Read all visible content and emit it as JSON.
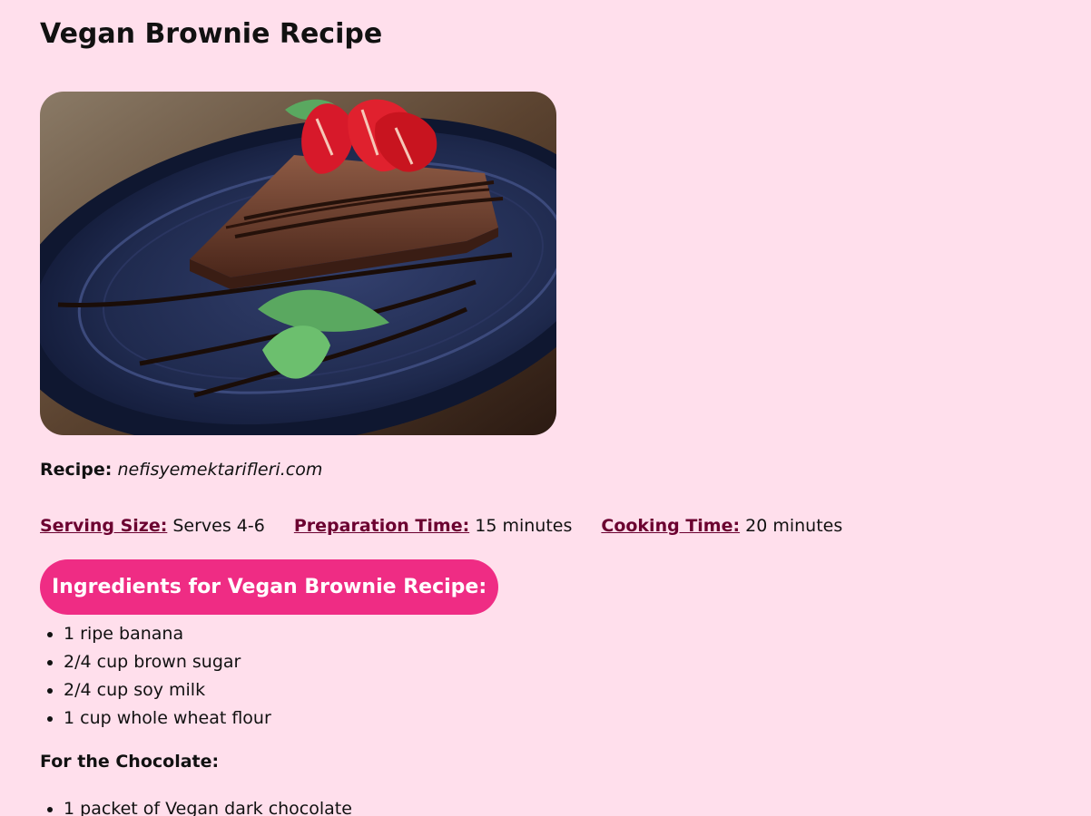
{
  "title": "Vegan Brownie Recipe",
  "image": {
    "icon": "brownie-photo"
  },
  "credit": {
    "label": "Recipe:",
    "source": "nefisyemektarifleri.com"
  },
  "meta": [
    {
      "label": "Serving Size:",
      "value": "Serves 4-6"
    },
    {
      "label": "Preparation Time:",
      "value": "15 minutes"
    },
    {
      "label": "Cooking Time:",
      "value": "20 minutes"
    }
  ],
  "ingredients_heading": "Ingredients for Vegan Brownie Recipe:",
  "ingredients": [
    "1 ripe banana",
    "2/4 cup brown sugar",
    "2/4 cup soy milk",
    "1 cup whole wheat flour"
  ],
  "chocolate_heading": "For the Chocolate:",
  "chocolate_items": [
    "1 packet of Vegan dark chocolate"
  ],
  "colors": {
    "background": "#ffdfec",
    "accent": "#ef2c84",
    "link": "#6b0030"
  }
}
